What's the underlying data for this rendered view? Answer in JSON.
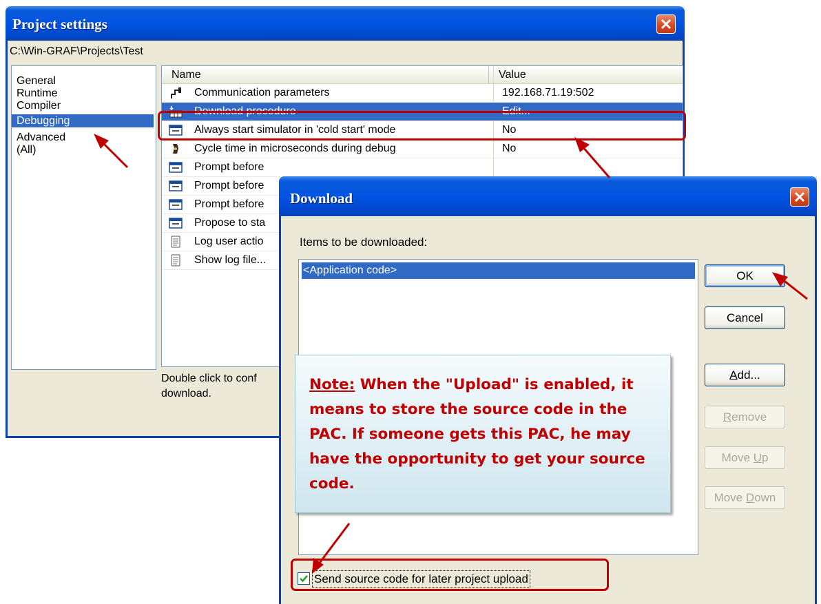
{
  "project_settings": {
    "title": "Project settings",
    "path": "C:\\Win-GRAF\\Projects\\Test",
    "categories": [
      "General",
      "Runtime",
      "Compiler",
      "Debugging",
      "Advanced",
      "(All)"
    ],
    "selected_category": "Debugging",
    "columns": {
      "name": "Name",
      "value": "Value"
    },
    "rows": [
      {
        "name": "Communication parameters",
        "value": "192.168.71.19:502",
        "icon": "network-plug-icon"
      },
      {
        "name": "Download procedure",
        "value": "Edit...",
        "icon": "download-grid-icon"
      },
      {
        "name": "Always start simulator in 'cold start' mode",
        "value": "No",
        "icon": "window-icon"
      },
      {
        "name": "Cycle time in microseconds during debug",
        "value": "No",
        "icon": "timer-icon"
      },
      {
        "name": "Prompt before",
        "value": "",
        "icon": "window-icon"
      },
      {
        "name": "Prompt before",
        "value": "",
        "icon": "window-icon"
      },
      {
        "name": "Prompt before",
        "value": "",
        "icon": "window-icon"
      },
      {
        "name": "Propose to sta",
        "value": "",
        "icon": "window-icon"
      },
      {
        "name": "Log user actio",
        "value": "",
        "icon": "notepad-icon"
      },
      {
        "name": "Show log file...",
        "value": "",
        "icon": "notepad-icon"
      }
    ],
    "hint_line1": "Double click to conf",
    "hint_line2": "download."
  },
  "download_dialog": {
    "title": "Download",
    "items_label": "Items to be downloaded:",
    "items": [
      "<Application code>"
    ],
    "buttons": {
      "ok": "OK",
      "cancel": "Cancel",
      "add_u": "A",
      "add_rest": "dd...",
      "remove_u": "R",
      "remove_rest": "emove",
      "move_up_pre": "Move ",
      "move_up_u": "U",
      "move_up_rest": "p",
      "move_down_pre": "Move ",
      "move_down_u": "D",
      "move_down_rest": "own"
    },
    "checkbox": {
      "label": "Send source code for later project upload",
      "checked": true
    }
  },
  "note": {
    "heading": "Note:",
    "text": " When the \"Upload\" is enabled, it means to store the source code in the PAC. If someone gets this PAC, he may have the opportunity to get your source code."
  },
  "colors": {
    "annotation": "#c00000",
    "selection": "#316ac5",
    "titlebar": "#0054e3"
  }
}
